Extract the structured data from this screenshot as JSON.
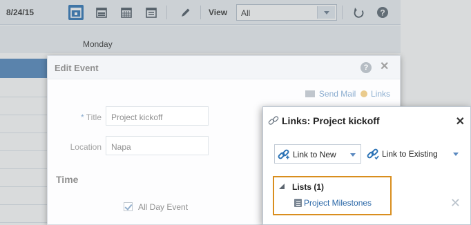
{
  "toolbar": {
    "date": "8/24/15",
    "view_label": "View",
    "view_value": "All"
  },
  "calendar": {
    "day_name": "Monday"
  },
  "edit_event": {
    "title": "Edit Event",
    "send_mail": "Send Mail",
    "links": "Links",
    "fields": {
      "title_label": "Title",
      "title_required": "*",
      "title_value": "Project kickoff",
      "location_label": "Location",
      "location_value": "Napa"
    },
    "time_section": "Time",
    "all_day_label": "All Day Event",
    "all_day_checked": true
  },
  "links_popup": {
    "title": "Links: Project kickoff",
    "link_to_new": "Link to New",
    "link_to_existing": "Link to Existing",
    "lists_header": "Lists (1)",
    "list_items": [
      "Project Milestones"
    ]
  },
  "colors": {
    "accent": "#2a72b5",
    "link": "#2b68a8",
    "highlight_border": "#d98e1e"
  }
}
